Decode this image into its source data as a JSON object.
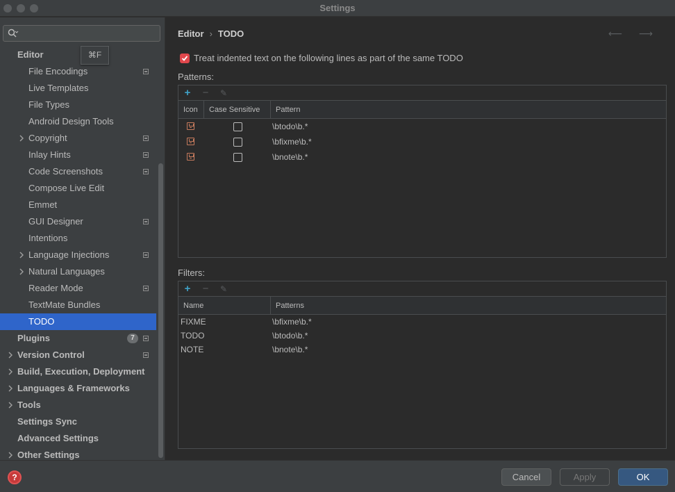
{
  "window": {
    "title": "Settings"
  },
  "search": {
    "placeholder": "",
    "shortcut_tooltip": "⌘F"
  },
  "sidebar": {
    "items": [
      {
        "label": "Editor",
        "level": 0,
        "bold": true,
        "expandable": false,
        "project": false
      },
      {
        "label": "File Encodings",
        "level": 1,
        "project": true
      },
      {
        "label": "Live Templates",
        "level": 1
      },
      {
        "label": "File Types",
        "level": 1
      },
      {
        "label": "Android Design Tools",
        "level": 1
      },
      {
        "label": "Copyright",
        "level": 1,
        "expandable": true,
        "project": true
      },
      {
        "label": "Inlay Hints",
        "level": 1,
        "project": true
      },
      {
        "label": "Code Screenshots",
        "level": 1,
        "project": true
      },
      {
        "label": "Compose Live Edit",
        "level": 1
      },
      {
        "label": "Emmet",
        "level": 1
      },
      {
        "label": "GUI Designer",
        "level": 1,
        "project": true
      },
      {
        "label": "Intentions",
        "level": 1
      },
      {
        "label": "Language Injections",
        "level": 1,
        "expandable": true,
        "project": true
      },
      {
        "label": "Natural Languages",
        "level": 1,
        "expandable": true
      },
      {
        "label": "Reader Mode",
        "level": 1,
        "project": true
      },
      {
        "label": "TextMate Bundles",
        "level": 1
      },
      {
        "label": "TODO",
        "level": 1,
        "selected": true
      },
      {
        "label": "Plugins",
        "level": 0,
        "bold": true,
        "badge": "7",
        "project": true
      },
      {
        "label": "Version Control",
        "level": 0,
        "bold": true,
        "expandable": true,
        "project": true
      },
      {
        "label": "Build, Execution, Deployment",
        "level": 0,
        "bold": true,
        "expandable": true
      },
      {
        "label": "Languages & Frameworks",
        "level": 0,
        "bold": true,
        "expandable": true
      },
      {
        "label": "Tools",
        "level": 0,
        "bold": true,
        "expandable": true
      },
      {
        "label": "Settings Sync",
        "level": 0,
        "bold": true
      },
      {
        "label": "Advanced Settings",
        "level": 0,
        "bold": true
      },
      {
        "label": "Other Settings",
        "level": 0,
        "bold": true,
        "expandable": true
      }
    ]
  },
  "breadcrumb": {
    "parent": "Editor",
    "separator": "›",
    "current": "TODO",
    "nav": "⟵ ⟶"
  },
  "option": {
    "label": "Treat indented text on the following lines as part of the same TODO",
    "checked": true
  },
  "patterns": {
    "label": "Patterns:",
    "toolbar": {
      "add": "+",
      "remove": "−",
      "edit": "✎"
    },
    "columns": [
      "Icon",
      "Case Sensitive",
      "Pattern"
    ],
    "rows": [
      {
        "case_sensitive": false,
        "pattern": "\\btodo\\b.*"
      },
      {
        "case_sensitive": false,
        "pattern": "\\bfixme\\b.*"
      },
      {
        "case_sensitive": false,
        "pattern": "\\bnote\\b.*"
      }
    ]
  },
  "filters": {
    "label": "Filters:",
    "toolbar": {
      "add": "+",
      "remove": "−",
      "edit": "✎"
    },
    "columns": [
      "Name",
      "Patterns"
    ],
    "rows": [
      {
        "name": "FIXME",
        "patterns": "\\bfixme\\b.*"
      },
      {
        "name": "TODO",
        "patterns": "\\btodo\\b.*"
      },
      {
        "name": "NOTE",
        "patterns": "\\bnote\\b.*"
      }
    ]
  },
  "footer": {
    "help": "?",
    "cancel": "Cancel",
    "apply": "Apply",
    "ok": "OK"
  },
  "colors": {
    "accent": "#2f65ca",
    "checkbox": "#e0474c",
    "ok_button": "#365880",
    "add_icon": "#3fa2c7",
    "todo_icon": "#c77b5d"
  }
}
